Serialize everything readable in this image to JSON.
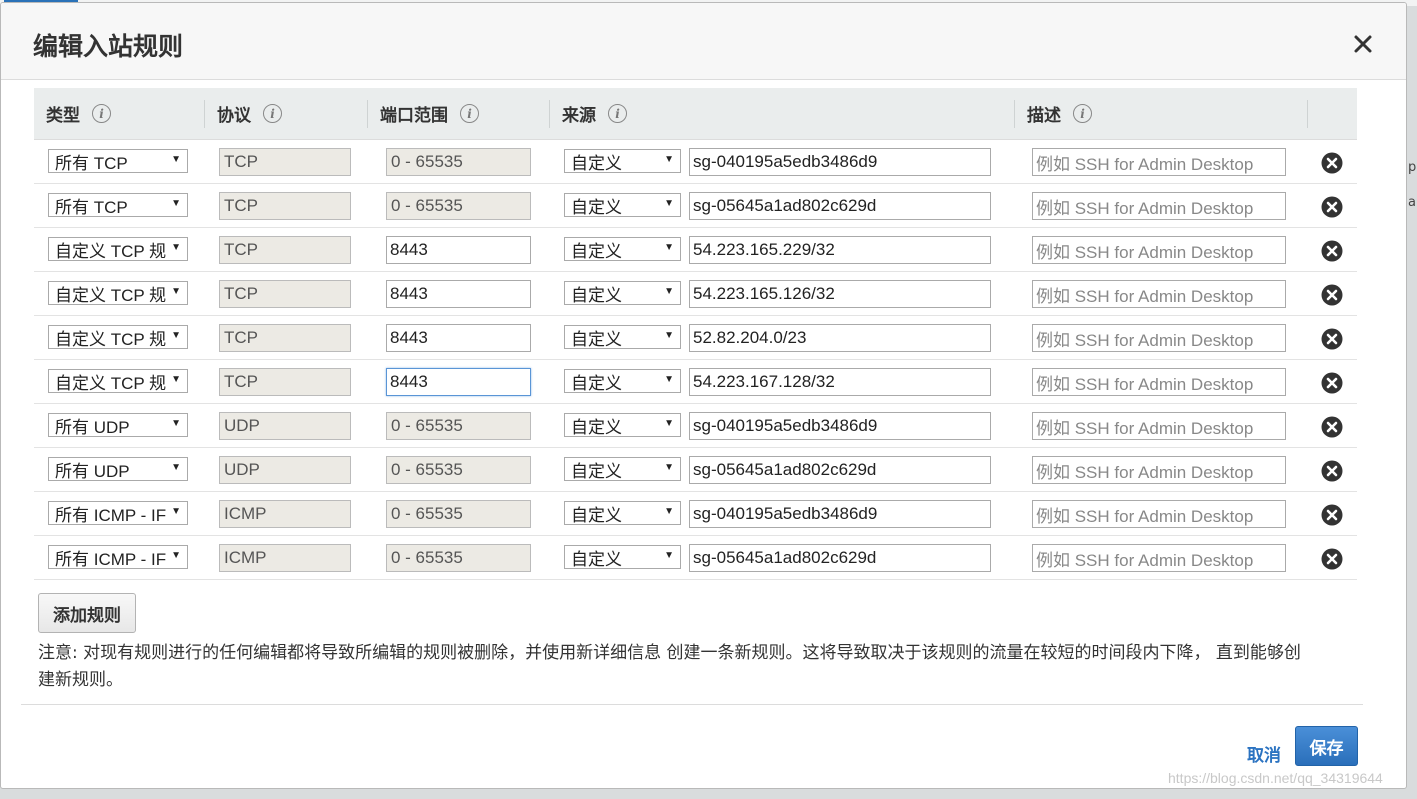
{
  "background": {
    "right_text_1": "p",
    "right_text_2": "a"
  },
  "watermark": "https://blog.csdn.net/qq_34319644",
  "modal": {
    "title": "编辑入站规则"
  },
  "table": {
    "headers": {
      "type": "类型",
      "protocol": "协议",
      "port_range": "端口范围",
      "source": "来源",
      "description": "描述"
    },
    "rows": [
      {
        "type": "所有 TCP",
        "protocol": "TCP",
        "port": "0 - 65535",
        "port_editable": false,
        "source_type": "自定义",
        "source": "sg-040195a5edb3486d9",
        "description_placeholder": "例如 SSH for Admin Desktop"
      },
      {
        "type": "所有 TCP",
        "protocol": "TCP",
        "port": "0 - 65535",
        "port_editable": false,
        "source_type": "自定义",
        "source": "sg-05645a1ad802c629d",
        "description_placeholder": "例如 SSH for Admin Desktop"
      },
      {
        "type": "自定义 TCP 规",
        "protocol": "TCP",
        "port": "8443",
        "port_editable": true,
        "source_type": "自定义",
        "source": "54.223.165.229/32",
        "description_placeholder": "例如 SSH for Admin Desktop"
      },
      {
        "type": "自定义 TCP 规",
        "protocol": "TCP",
        "port": "8443",
        "port_editable": true,
        "source_type": "自定义",
        "source": "54.223.165.126/32",
        "description_placeholder": "例如 SSH for Admin Desktop"
      },
      {
        "type": "自定义 TCP 规",
        "protocol": "TCP",
        "port": "8443",
        "port_editable": true,
        "source_type": "自定义",
        "source": "52.82.204.0/23",
        "description_placeholder": "例如 SSH for Admin Desktop"
      },
      {
        "type": "自定义 TCP 规",
        "protocol": "TCP",
        "port": "8443",
        "port_editable": true,
        "focused": true,
        "source_type": "自定义",
        "source": "54.223.167.128/32",
        "description_placeholder": "例如 SSH for Admin Desktop"
      },
      {
        "type": "所有 UDP",
        "protocol": "UDP",
        "port": "0 - 65535",
        "port_editable": false,
        "source_type": "自定义",
        "source": "sg-040195a5edb3486d9",
        "description_placeholder": "例如 SSH for Admin Desktop"
      },
      {
        "type": "所有 UDP",
        "protocol": "UDP",
        "port": "0 - 65535",
        "port_editable": false,
        "source_type": "自定义",
        "source": "sg-05645a1ad802c629d",
        "description_placeholder": "例如 SSH for Admin Desktop"
      },
      {
        "type": "所有 ICMP - IF",
        "protocol": "ICMP",
        "port": "0 - 65535",
        "port_editable": false,
        "source_type": "自定义",
        "source": "sg-040195a5edb3486d9",
        "description_placeholder": "例如 SSH for Admin Desktop"
      },
      {
        "type": "所有 ICMP - IF",
        "protocol": "ICMP",
        "port": "0 - 65535",
        "port_editable": false,
        "source_type": "自定义",
        "source": "sg-05645a1ad802c629d",
        "description_placeholder": "例如 SSH for Admin Desktop"
      }
    ]
  },
  "add_rule_label": "添加规则",
  "note": "注意: 对现有规则进行的任何编辑都将导致所编辑的规则被删除，并使用新详细信息 创建一条新规则。这将导致取决于该规则的流量在较短的时间段内下降， 直到能够创建新规则。",
  "footer": {
    "cancel_label": "取消",
    "save_label": "保存"
  },
  "colors": {
    "accent": "#2b73c1",
    "primary_button": "#2a6fba",
    "header_bg": "#eaeded",
    "readonly_bg": "#eceae4"
  }
}
